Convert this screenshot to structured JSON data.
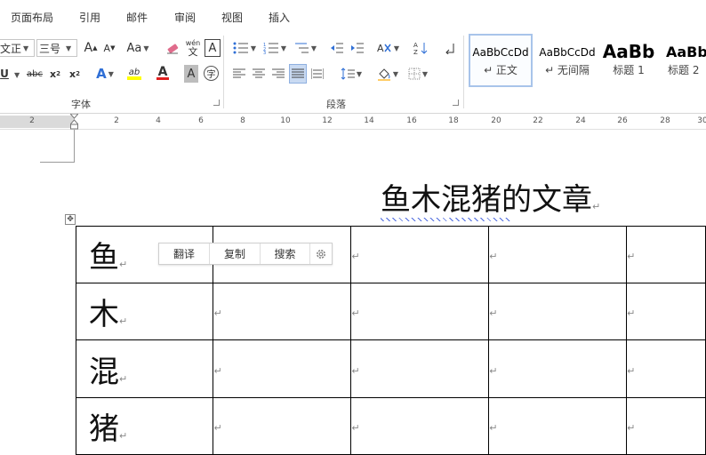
{
  "tabs": [
    "页面布局",
    "引用",
    "邮件",
    "审阅",
    "视图",
    "插入"
  ],
  "font_group": {
    "font_name": "文正",
    "font_size": "三号",
    "grow_label": "A",
    "shrink_label": "A",
    "case_label": "Aa",
    "phonetic_top": "wén",
    "phonetic_bottom": "文",
    "charborder_label": "A",
    "underline_label": "U",
    "strike_label": "abc",
    "sub_label": "x",
    "sup_label": "x",
    "effect_label": "A",
    "highlight_label": "ab",
    "fontcolor_label": "A",
    "shade_label": "A",
    "enclose_label": "字",
    "label": "字体"
  },
  "paragraph_group": {
    "label": "段落"
  },
  "styles": [
    {
      "preview": "AaBbCcDd",
      "name": "↵ 正文"
    },
    {
      "preview": "AaBbCcDd",
      "name": "↵ 无间隔"
    },
    {
      "preview": "AaBb",
      "name": "标题 1"
    },
    {
      "preview": "AaBb",
      "name": "标题 2"
    }
  ],
  "ruler_numbers": [
    "2",
    "2",
    "4",
    "6",
    "8",
    "10",
    "12",
    "14",
    "16",
    "18",
    "20",
    "22",
    "24",
    "26",
    "28",
    "30"
  ],
  "document": {
    "title": "鱼木混猪的文章",
    "paragraph_mark": "↵",
    "table_move_handle": "✥",
    "rows": [
      {
        "char": "鱼"
      },
      {
        "char": "木"
      },
      {
        "char": "混"
      },
      {
        "char": "猪"
      }
    ]
  },
  "context_toolbar": {
    "translate": "翻译",
    "copy": "复制",
    "search": "搜索"
  },
  "colors": {
    "highlight_yellow": "#ffff00",
    "font_red": "#e02020",
    "accent_blue": "#2f6fd6",
    "selected_style_border": "#a8c4ea"
  }
}
